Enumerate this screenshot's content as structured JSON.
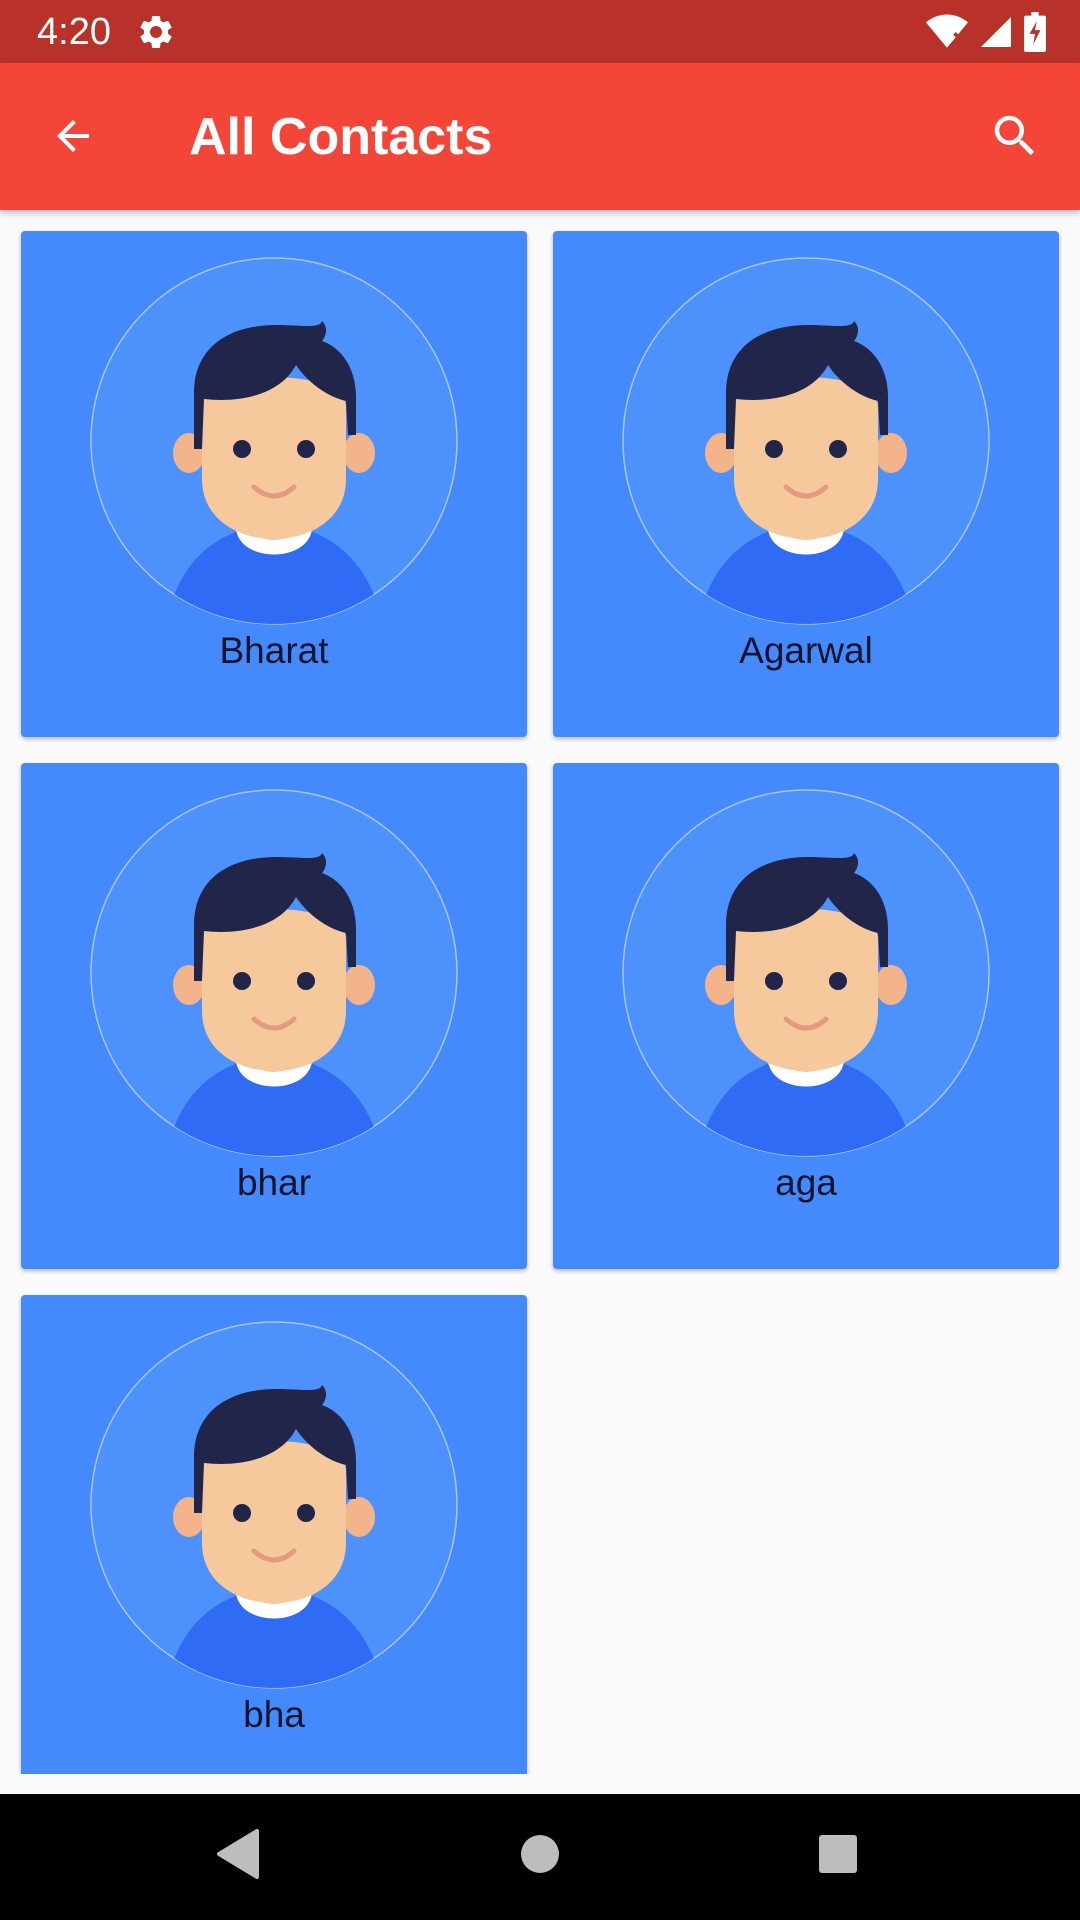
{
  "status_bar": {
    "time": "4:20",
    "icons": [
      "settings-icon",
      "wifi-icon",
      "signal-icon",
      "battery-icon"
    ]
  },
  "app_bar": {
    "title": "All Contacts",
    "back_icon": "arrow-back-icon",
    "search_icon": "search-icon"
  },
  "contacts": [
    {
      "name": "Bharat"
    },
    {
      "name": "Agarwal"
    },
    {
      "name": "bhar"
    },
    {
      "name": "aga"
    },
    {
      "name": "bha"
    }
  ],
  "nav_bar": {
    "icons": [
      "back-triangle-icon",
      "home-circle-icon",
      "recents-square-icon"
    ]
  },
  "colors": {
    "status_bar": "#B83229",
    "app_bar": "#F44539",
    "card": "#448AFC",
    "background": "#FAFAFA"
  }
}
